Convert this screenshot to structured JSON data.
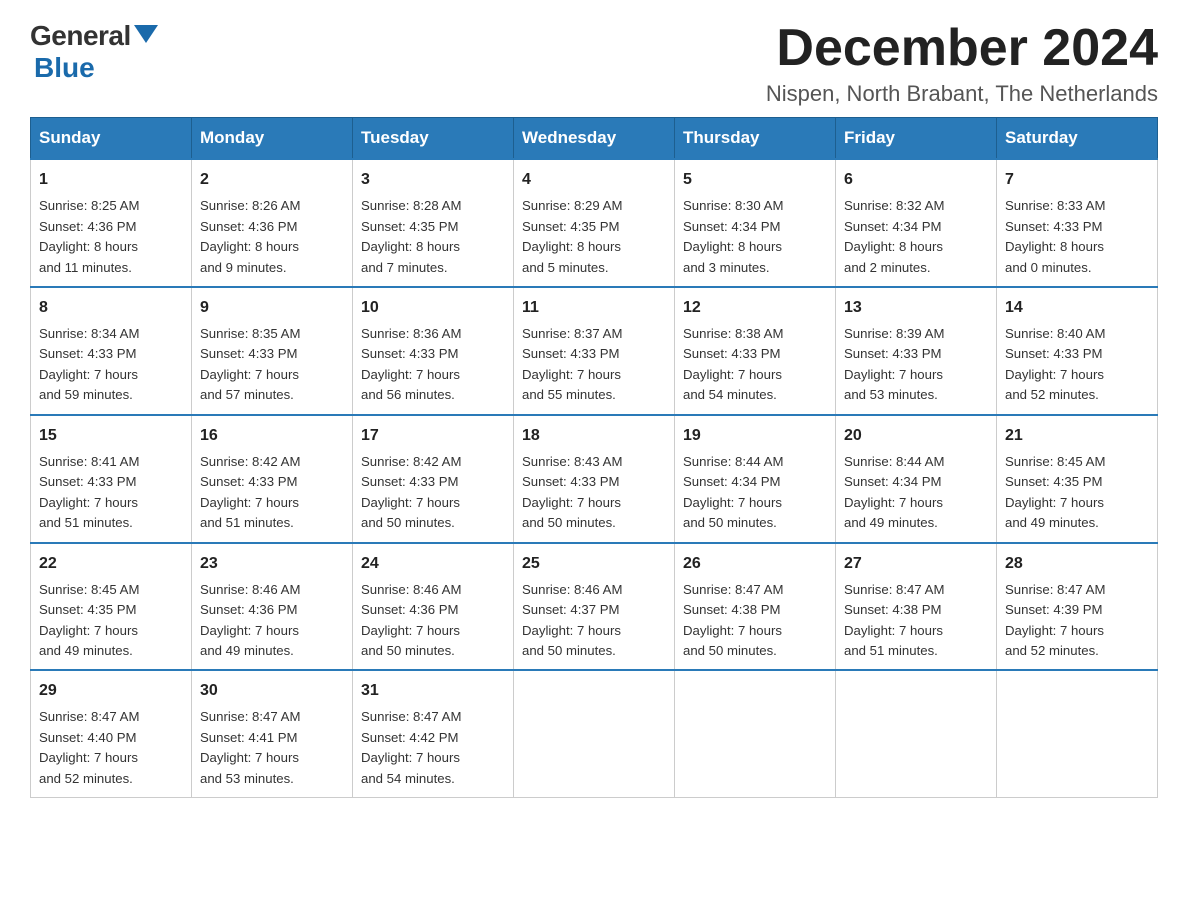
{
  "header": {
    "logo_text_general": "General",
    "logo_text_blue": "Blue",
    "title": "December 2024",
    "subtitle": "Nispen, North Brabant, The Netherlands"
  },
  "weekdays": [
    "Sunday",
    "Monday",
    "Tuesday",
    "Wednesday",
    "Thursday",
    "Friday",
    "Saturday"
  ],
  "weeks": [
    [
      {
        "day": "1",
        "sunrise": "Sunrise: 8:25 AM",
        "sunset": "Sunset: 4:36 PM",
        "daylight": "Daylight: 8 hours",
        "daylight2": "and 11 minutes."
      },
      {
        "day": "2",
        "sunrise": "Sunrise: 8:26 AM",
        "sunset": "Sunset: 4:36 PM",
        "daylight": "Daylight: 8 hours",
        "daylight2": "and 9 minutes."
      },
      {
        "day": "3",
        "sunrise": "Sunrise: 8:28 AM",
        "sunset": "Sunset: 4:35 PM",
        "daylight": "Daylight: 8 hours",
        "daylight2": "and 7 minutes."
      },
      {
        "day": "4",
        "sunrise": "Sunrise: 8:29 AM",
        "sunset": "Sunset: 4:35 PM",
        "daylight": "Daylight: 8 hours",
        "daylight2": "and 5 minutes."
      },
      {
        "day": "5",
        "sunrise": "Sunrise: 8:30 AM",
        "sunset": "Sunset: 4:34 PM",
        "daylight": "Daylight: 8 hours",
        "daylight2": "and 3 minutes."
      },
      {
        "day": "6",
        "sunrise": "Sunrise: 8:32 AM",
        "sunset": "Sunset: 4:34 PM",
        "daylight": "Daylight: 8 hours",
        "daylight2": "and 2 minutes."
      },
      {
        "day": "7",
        "sunrise": "Sunrise: 8:33 AM",
        "sunset": "Sunset: 4:33 PM",
        "daylight": "Daylight: 8 hours",
        "daylight2": "and 0 minutes."
      }
    ],
    [
      {
        "day": "8",
        "sunrise": "Sunrise: 8:34 AM",
        "sunset": "Sunset: 4:33 PM",
        "daylight": "Daylight: 7 hours",
        "daylight2": "and 59 minutes."
      },
      {
        "day": "9",
        "sunrise": "Sunrise: 8:35 AM",
        "sunset": "Sunset: 4:33 PM",
        "daylight": "Daylight: 7 hours",
        "daylight2": "and 57 minutes."
      },
      {
        "day": "10",
        "sunrise": "Sunrise: 8:36 AM",
        "sunset": "Sunset: 4:33 PM",
        "daylight": "Daylight: 7 hours",
        "daylight2": "and 56 minutes."
      },
      {
        "day": "11",
        "sunrise": "Sunrise: 8:37 AM",
        "sunset": "Sunset: 4:33 PM",
        "daylight": "Daylight: 7 hours",
        "daylight2": "and 55 minutes."
      },
      {
        "day": "12",
        "sunrise": "Sunrise: 8:38 AM",
        "sunset": "Sunset: 4:33 PM",
        "daylight": "Daylight: 7 hours",
        "daylight2": "and 54 minutes."
      },
      {
        "day": "13",
        "sunrise": "Sunrise: 8:39 AM",
        "sunset": "Sunset: 4:33 PM",
        "daylight": "Daylight: 7 hours",
        "daylight2": "and 53 minutes."
      },
      {
        "day": "14",
        "sunrise": "Sunrise: 8:40 AM",
        "sunset": "Sunset: 4:33 PM",
        "daylight": "Daylight: 7 hours",
        "daylight2": "and 52 minutes."
      }
    ],
    [
      {
        "day": "15",
        "sunrise": "Sunrise: 8:41 AM",
        "sunset": "Sunset: 4:33 PM",
        "daylight": "Daylight: 7 hours",
        "daylight2": "and 51 minutes."
      },
      {
        "day": "16",
        "sunrise": "Sunrise: 8:42 AM",
        "sunset": "Sunset: 4:33 PM",
        "daylight": "Daylight: 7 hours",
        "daylight2": "and 51 minutes."
      },
      {
        "day": "17",
        "sunrise": "Sunrise: 8:42 AM",
        "sunset": "Sunset: 4:33 PM",
        "daylight": "Daylight: 7 hours",
        "daylight2": "and 50 minutes."
      },
      {
        "day": "18",
        "sunrise": "Sunrise: 8:43 AM",
        "sunset": "Sunset: 4:33 PM",
        "daylight": "Daylight: 7 hours",
        "daylight2": "and 50 minutes."
      },
      {
        "day": "19",
        "sunrise": "Sunrise: 8:44 AM",
        "sunset": "Sunset: 4:34 PM",
        "daylight": "Daylight: 7 hours",
        "daylight2": "and 50 minutes."
      },
      {
        "day": "20",
        "sunrise": "Sunrise: 8:44 AM",
        "sunset": "Sunset: 4:34 PM",
        "daylight": "Daylight: 7 hours",
        "daylight2": "and 49 minutes."
      },
      {
        "day": "21",
        "sunrise": "Sunrise: 8:45 AM",
        "sunset": "Sunset: 4:35 PM",
        "daylight": "Daylight: 7 hours",
        "daylight2": "and 49 minutes."
      }
    ],
    [
      {
        "day": "22",
        "sunrise": "Sunrise: 8:45 AM",
        "sunset": "Sunset: 4:35 PM",
        "daylight": "Daylight: 7 hours",
        "daylight2": "and 49 minutes."
      },
      {
        "day": "23",
        "sunrise": "Sunrise: 8:46 AM",
        "sunset": "Sunset: 4:36 PM",
        "daylight": "Daylight: 7 hours",
        "daylight2": "and 49 minutes."
      },
      {
        "day": "24",
        "sunrise": "Sunrise: 8:46 AM",
        "sunset": "Sunset: 4:36 PM",
        "daylight": "Daylight: 7 hours",
        "daylight2": "and 50 minutes."
      },
      {
        "day": "25",
        "sunrise": "Sunrise: 8:46 AM",
        "sunset": "Sunset: 4:37 PM",
        "daylight": "Daylight: 7 hours",
        "daylight2": "and 50 minutes."
      },
      {
        "day": "26",
        "sunrise": "Sunrise: 8:47 AM",
        "sunset": "Sunset: 4:38 PM",
        "daylight": "Daylight: 7 hours",
        "daylight2": "and 50 minutes."
      },
      {
        "day": "27",
        "sunrise": "Sunrise: 8:47 AM",
        "sunset": "Sunset: 4:38 PM",
        "daylight": "Daylight: 7 hours",
        "daylight2": "and 51 minutes."
      },
      {
        "day": "28",
        "sunrise": "Sunrise: 8:47 AM",
        "sunset": "Sunset: 4:39 PM",
        "daylight": "Daylight: 7 hours",
        "daylight2": "and 52 minutes."
      }
    ],
    [
      {
        "day": "29",
        "sunrise": "Sunrise: 8:47 AM",
        "sunset": "Sunset: 4:40 PM",
        "daylight": "Daylight: 7 hours",
        "daylight2": "and 52 minutes."
      },
      {
        "day": "30",
        "sunrise": "Sunrise: 8:47 AM",
        "sunset": "Sunset: 4:41 PM",
        "daylight": "Daylight: 7 hours",
        "daylight2": "and 53 minutes."
      },
      {
        "day": "31",
        "sunrise": "Sunrise: 8:47 AM",
        "sunset": "Sunset: 4:42 PM",
        "daylight": "Daylight: 7 hours",
        "daylight2": "and 54 minutes."
      },
      null,
      null,
      null,
      null
    ]
  ]
}
